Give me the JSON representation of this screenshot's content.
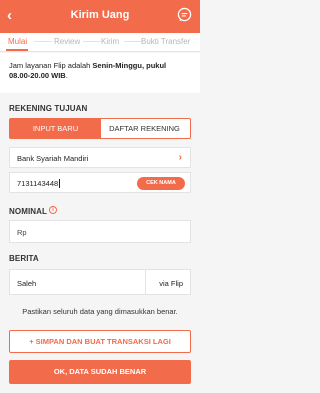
{
  "header": {
    "title": "Kirim Uang",
    "back_icon": "arrow-left-icon",
    "chat_icon": "chat-bubble-icon"
  },
  "tabs": [
    {
      "label": "Mulai",
      "active": true
    },
    {
      "label": "Review",
      "active": false
    },
    {
      "label": "Kirim",
      "active": false
    },
    {
      "label": "Bukti Transfer",
      "active": false
    }
  ],
  "info": {
    "prefix": "Jam layanan Flip adalah ",
    "days": "Senin-Minggu, pukul",
    "hours": "08.00-20.00 WIB",
    "suffix": "."
  },
  "rekening": {
    "title": "REKENING TUJUAN",
    "option_new": "INPUT BARU",
    "option_list": "DAFTAR REKENING",
    "bank": "Bank Syariah Mandiri",
    "account_number": "7131143448",
    "check_button": "CEK NAMA"
  },
  "nominal": {
    "title": "NOMINAL",
    "prefix": "Rp"
  },
  "berita": {
    "title": "BERITA",
    "value": "Saleh",
    "suffix": "via Flip"
  },
  "confirm_text": "Pastikan seluruh data yang dimasukkan benar.",
  "buttons": {
    "save_and_new": "+ SIMPAN DAN BUAT TRANSAKSI LAGI",
    "ok": "OK, DATA SUDAH BENAR"
  },
  "colors": {
    "accent": "#f26b4b",
    "background": "#f5f5f5"
  }
}
